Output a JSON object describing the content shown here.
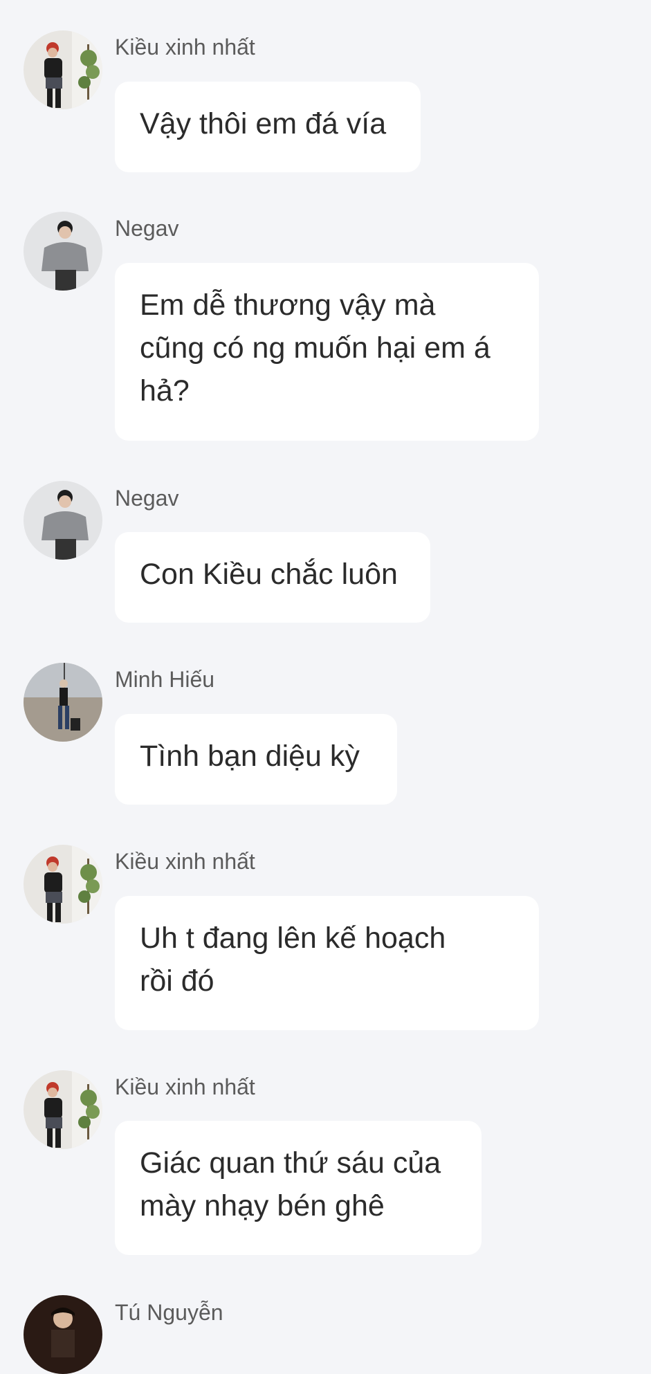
{
  "messages": [
    {
      "sender": "Kiều xinh nhất",
      "avatar": "kieu-avatar",
      "lines": [
        "Vậy thôi em đá vía"
      ]
    },
    {
      "sender": "Negav",
      "avatar": "negav-avatar",
      "lines": [
        "Em dễ thương vậy mà",
        "cũng có ng muốn hại em á",
        "hả?"
      ]
    },
    {
      "sender": "Negav",
      "avatar": "negav-avatar",
      "lines": [
        "Con Kiều chắc luôn"
      ]
    },
    {
      "sender": "Minh Hiếu",
      "avatar": "minh-hieu-avatar",
      "lines": [
        "Tình bạn diệu kỳ"
      ]
    },
    {
      "sender": "Kiều xinh nhất",
      "avatar": "kieu-avatar",
      "lines": [
        "Uh t đang lên kế hoạch",
        "rồi đó"
      ]
    },
    {
      "sender": "Kiều xinh nhất",
      "avatar": "kieu-avatar",
      "lines": [
        "Giác quan thứ sáu của",
        "mày nhạy bén ghê"
      ]
    },
    {
      "sender": "Tú Nguyễn",
      "avatar": "tu-nguyen-avatar",
      "lines": []
    }
  ],
  "colors": {
    "background": "#f4f5f8",
    "bubble": "#ffffff",
    "sender_text": "#5b5b5b",
    "message_text": "#2b2b2b"
  }
}
